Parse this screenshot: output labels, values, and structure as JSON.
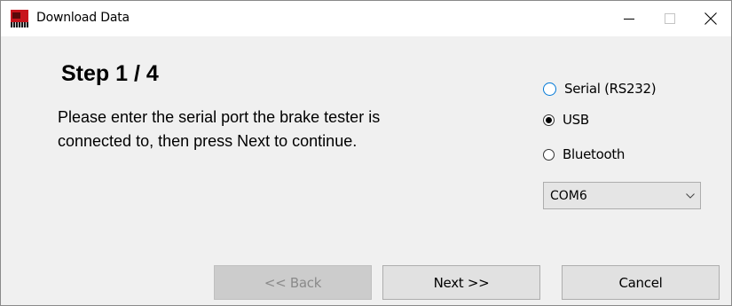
{
  "window": {
    "title": "Download Data",
    "icon": "brake-tester-app-icon"
  },
  "title_controls": {
    "minimize_icon": "minimize-icon",
    "maximize_icon": "maximize-icon",
    "close_icon": "close-icon"
  },
  "wizard": {
    "step_title": "Step 1 / 4",
    "instructions_line1": "Please enter the serial port the brake tester is",
    "instructions_line2": "connected to, then press Next to continue."
  },
  "connection": {
    "options": [
      {
        "label": "Serial (RS232)",
        "checked": false,
        "focused": true
      },
      {
        "label": "USB",
        "checked": true,
        "focused": false
      },
      {
        "label": "Bluetooth",
        "checked": false,
        "focused": false
      }
    ],
    "port": {
      "value": "COM6"
    }
  },
  "buttons": {
    "back": "<< Back",
    "next": "Next >>",
    "cancel": "Cancel"
  },
  "colors": {
    "focus_accent": "#0078d7",
    "window_bg": "#f0f0f0",
    "disabled_text": "#8a8a8a"
  }
}
